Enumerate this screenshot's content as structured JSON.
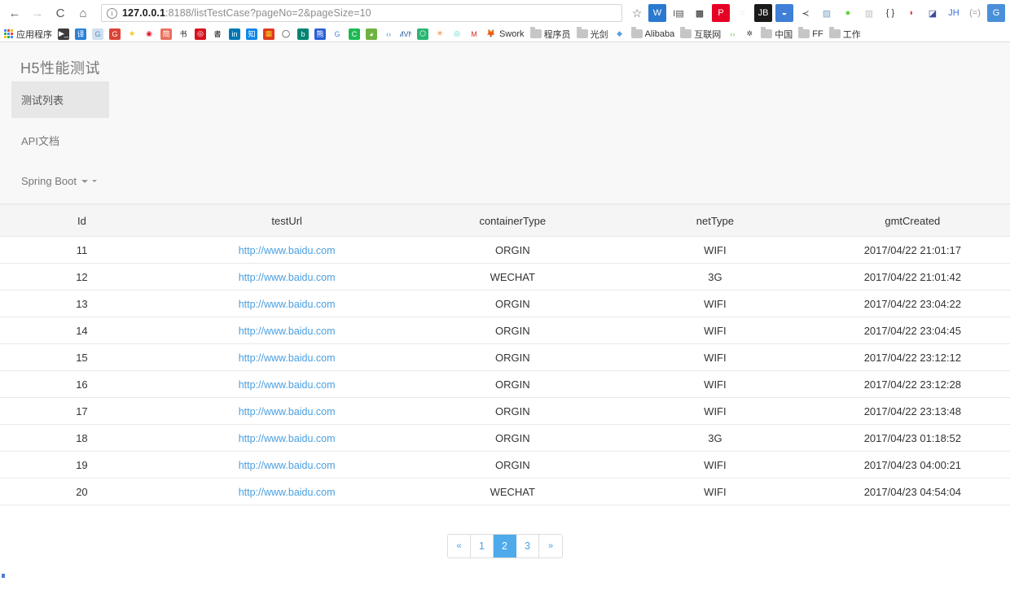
{
  "browser": {
    "back_icon": "←",
    "forward_icon": "→",
    "reload_icon": "C",
    "home_icon": "⌂",
    "info_icon": "i",
    "star_icon": "☆",
    "url_host": "127.0.0.1",
    "url_rest": ":8188/listTestCase?pageNo=2&pageSize=10",
    "extensions": [
      {
        "name": "wps-extension-icon",
        "glyph": "W",
        "bg": "#2a79d1",
        "fg": "#ffffff"
      },
      {
        "name": "image-extension-icon",
        "glyph": "I▤",
        "bg": "#ffffff",
        "fg": "#4a4a4a"
      },
      {
        "name": "qrcode-extension-icon",
        "glyph": "▩",
        "bg": "#ffffff",
        "fg": "#222222"
      },
      {
        "name": "pinterest-extension-icon",
        "glyph": "P",
        "bg": "#e60023",
        "fg": "#ffffff"
      },
      {
        "name": "circle-gray-extension-icon",
        "glyph": "◌",
        "bg": "#ffffff",
        "fg": "#c9c9c9"
      },
      {
        "name": "jetbrains-extension-icon",
        "glyph": "JB",
        "bg": "#1a1a1a",
        "fg": "#ffffff"
      },
      {
        "name": "pocket-extension-icon",
        "glyph": "◒",
        "bg": "#3f7fd8",
        "fg": "#ffffff"
      },
      {
        "name": "share-extension-icon",
        "glyph": "≺",
        "bg": "#ffffff",
        "fg": "#3c3c3c"
      },
      {
        "name": "screenshot-extension-icon",
        "glyph": "▨",
        "bg": "#ffffff",
        "fg": "#7a9ec6"
      },
      {
        "name": "green-dot-extension-icon",
        "glyph": "●",
        "bg": "#ffffff",
        "fg": "#5cd63a"
      },
      {
        "name": "columns-extension-icon",
        "glyph": "▥",
        "bg": "#ffffff",
        "fg": "#bdbdbd"
      },
      {
        "name": "json-extension-icon",
        "glyph": "{ }",
        "bg": "#ffffff",
        "fg": "#333333"
      },
      {
        "name": "record-extension-icon",
        "glyph": "◗",
        "bg": "#ffffff",
        "fg": "#f03b3b"
      },
      {
        "name": "adblock-extension-icon",
        "glyph": "◪",
        "bg": "#ffffff",
        "fg": "#3b4a9e"
      },
      {
        "name": "jh-extension-icon",
        "glyph": "JH",
        "bg": "#ffffff",
        "fg": "#3f6fd8"
      },
      {
        "name": "equals-extension-icon",
        "glyph": "(=)",
        "bg": "#ffffff",
        "fg": "#9a9a9a"
      },
      {
        "name": "google-translate-extension-icon",
        "glyph": "G",
        "bg": "#4a90d9",
        "fg": "#ffffff"
      }
    ]
  },
  "bookmarks": [
    {
      "name": "apps-grid",
      "type": "apps",
      "label": "应用程序"
    },
    {
      "name": "terminal-bookmark",
      "type": "icon",
      "glyph": "▶_",
      "bg": "#3c3c3c",
      "fg": "#ffffff",
      "label": ""
    },
    {
      "name": "translate-bookmark",
      "type": "icon",
      "glyph": "译",
      "bg": "#2a7fd6",
      "fg": "#ffffff",
      "label": ""
    },
    {
      "name": "google-translate-bookmark",
      "type": "icon",
      "glyph": "G",
      "bg": "#cfe0f0",
      "fg": "#5a8fc0",
      "label": ""
    },
    {
      "name": "google-plus-bookmark",
      "type": "icon",
      "glyph": "G",
      "bg": "#db4437",
      "fg": "#ffffff",
      "label": ""
    },
    {
      "name": "star-bookmark",
      "type": "icon",
      "glyph": "★",
      "bg": "#ffffff",
      "fg": "#f5c518",
      "label": ""
    },
    {
      "name": "weibo-bookmark",
      "type": "icon",
      "glyph": "◉",
      "bg": "#ffffff",
      "fg": "#e6162d",
      "label": ""
    },
    {
      "name": "jianshu-bookmark",
      "type": "icon",
      "glyph": "简",
      "bg": "#ea6f5a",
      "fg": "#ffffff",
      "label": ""
    },
    {
      "name": "calligraphy-bookmark",
      "type": "icon",
      "glyph": "书",
      "bg": "#ffffff",
      "fg": "#1a1a1a",
      "label": ""
    },
    {
      "name": "netease-music-bookmark",
      "type": "icon",
      "glyph": "◎",
      "bg": "#d7121f",
      "fg": "#ffffff",
      "label": ""
    },
    {
      "name": "book-bookmark",
      "type": "icon",
      "glyph": "書",
      "bg": "#ffffff",
      "fg": "#1a1a1a",
      "label": ""
    },
    {
      "name": "linkedin-bookmark",
      "type": "icon",
      "glyph": "in",
      "bg": "#0077b5",
      "fg": "#ffffff",
      "label": ""
    },
    {
      "name": "zhihu-bookmark",
      "type": "icon",
      "glyph": "知",
      "bg": "#0f88eb",
      "fg": "#ffffff",
      "label": ""
    },
    {
      "name": "colorful-bookmark",
      "type": "icon",
      "glyph": "▦",
      "bg": "#e03a1e",
      "fg": "#f5d020",
      "label": ""
    },
    {
      "name": "github-bookmark",
      "type": "icon",
      "glyph": "◯",
      "bg": "#ffffff",
      "fg": "#1a1a1a",
      "label": ""
    },
    {
      "name": "bing-bookmark",
      "type": "icon",
      "glyph": "b",
      "bg": "#008373",
      "fg": "#ffffff",
      "label": ""
    },
    {
      "name": "baidu-bookmark",
      "type": "icon",
      "glyph": "熊",
      "bg": "#2a5fd6",
      "fg": "#ffffff",
      "label": ""
    },
    {
      "name": "google-bookmark",
      "type": "icon",
      "glyph": "G",
      "bg": "#ffffff",
      "fg": "#4285f4",
      "label": ""
    },
    {
      "name": "c-green-bookmark",
      "type": "icon",
      "glyph": "C",
      "bg": "#1db954",
      "fg": "#ffffff",
      "label": ""
    },
    {
      "name": "leaf-bookmark",
      "type": "icon",
      "glyph": "◕",
      "bg": "#6db33f",
      "fg": "#ffffff",
      "label": ""
    },
    {
      "name": "code-bookmark",
      "type": "icon",
      "glyph": "‹›",
      "bg": "#ffffff",
      "fg": "#2a8fe0",
      "label": ""
    },
    {
      "name": "mvn-bookmark",
      "type": "icon",
      "glyph": "MVN",
      "bg": "#ffffff",
      "fg": "#2a5f9e",
      "label": ""
    },
    {
      "name": "hex-green-bookmark",
      "type": "icon",
      "glyph": "⬡",
      "bg": "#2bb673",
      "fg": "#ffffff",
      "label": ""
    },
    {
      "name": "gear-orange-bookmark",
      "type": "icon",
      "glyph": "✳",
      "bg": "#ffffff",
      "fg": "#f07a21",
      "label": ""
    },
    {
      "name": "infinity-bookmark",
      "type": "icon",
      "glyph": "◎",
      "bg": "#ffffff",
      "fg": "#4dd0c8",
      "label": ""
    },
    {
      "name": "gmail-bookmark",
      "type": "icon",
      "glyph": "M",
      "bg": "#ffffff",
      "fg": "#d93025",
      "label": ""
    },
    {
      "name": "gitlab-bookmark",
      "type": "icon",
      "glyph": "🦊",
      "bg": "#ffffff",
      "fg": "#e24329",
      "label": "Swork"
    },
    {
      "name": "folder-chengxuyuan",
      "type": "folder",
      "label": "程序员"
    },
    {
      "name": "folder-guangjian",
      "type": "folder",
      "label": "光剑"
    },
    {
      "name": "sketch-bookmark",
      "type": "icon",
      "glyph": "◆",
      "bg": "#ffffff",
      "fg": "#5aa0e0",
      "label": ""
    },
    {
      "name": "folder-alibaba",
      "type": "folder",
      "label": "Alibaba"
    },
    {
      "name": "folder-hulianwang",
      "type": "folder",
      "label": "互联网"
    },
    {
      "name": "code-green-bookmark",
      "type": "icon",
      "glyph": "‹›",
      "bg": "#ffffff",
      "fg": "#6cc04a",
      "label": ""
    },
    {
      "name": "gear-bookmark",
      "type": "icon",
      "glyph": "✲",
      "bg": "#ffffff",
      "fg": "#3c3c3c",
      "label": ""
    },
    {
      "name": "folder-zhongguo",
      "type": "folder",
      "label": "中国"
    },
    {
      "name": "folder-ff",
      "type": "folder",
      "label": "FF"
    },
    {
      "name": "folder-gongzuo",
      "type": "folder",
      "label": "工作"
    }
  ],
  "sidebar": {
    "brand": "H5性能测试",
    "items": [
      {
        "label": "测试列表",
        "active": true
      },
      {
        "label": "API文档",
        "active": false
      },
      {
        "label": "Spring Boot",
        "active": false,
        "has_caret": true
      }
    ]
  },
  "table": {
    "columns": [
      "Id",
      "testUrl",
      "containerType",
      "netType",
      "gmtCreated"
    ],
    "rows": [
      {
        "id": "11",
        "testUrl": "http://www.baidu.com",
        "containerType": "ORGIN",
        "netType": "WIFI",
        "gmtCreated": "2017/04/22 21:01:17"
      },
      {
        "id": "12",
        "testUrl": "http://www.baidu.com",
        "containerType": "WECHAT",
        "netType": "3G",
        "gmtCreated": "2017/04/22 21:01:42"
      },
      {
        "id": "13",
        "testUrl": "http://www.baidu.com",
        "containerType": "ORGIN",
        "netType": "WIFI",
        "gmtCreated": "2017/04/22 23:04:22"
      },
      {
        "id": "14",
        "testUrl": "http://www.baidu.com",
        "containerType": "ORGIN",
        "netType": "WIFI",
        "gmtCreated": "2017/04/22 23:04:45"
      },
      {
        "id": "15",
        "testUrl": "http://www.baidu.com",
        "containerType": "ORGIN",
        "netType": "WIFI",
        "gmtCreated": "2017/04/22 23:12:12"
      },
      {
        "id": "16",
        "testUrl": "http://www.baidu.com",
        "containerType": "ORGIN",
        "netType": "WIFI",
        "gmtCreated": "2017/04/22 23:12:28"
      },
      {
        "id": "17",
        "testUrl": "http://www.baidu.com",
        "containerType": "ORGIN",
        "netType": "WIFI",
        "gmtCreated": "2017/04/22 23:13:48"
      },
      {
        "id": "18",
        "testUrl": "http://www.baidu.com",
        "containerType": "ORGIN",
        "netType": "3G",
        "gmtCreated": "2017/04/23 01:18:52"
      },
      {
        "id": "19",
        "testUrl": "http://www.baidu.com",
        "containerType": "ORGIN",
        "netType": "WIFI",
        "gmtCreated": "2017/04/23 04:00:21"
      },
      {
        "id": "20",
        "testUrl": "http://www.baidu.com",
        "containerType": "WECHAT",
        "netType": "WIFI",
        "gmtCreated": "2017/04/23 04:54:04"
      }
    ]
  },
  "pagination": {
    "prev": "«",
    "next": "»",
    "pages": [
      "1",
      "2",
      "3"
    ],
    "current": "2"
  },
  "colors": {
    "accent": "#4eaaea",
    "link": "#4a9fe0",
    "nav_bg": "#f8f8f8",
    "nav_active_bg": "#e7e7e7",
    "table_header_bg": "#f5f5f5"
  }
}
